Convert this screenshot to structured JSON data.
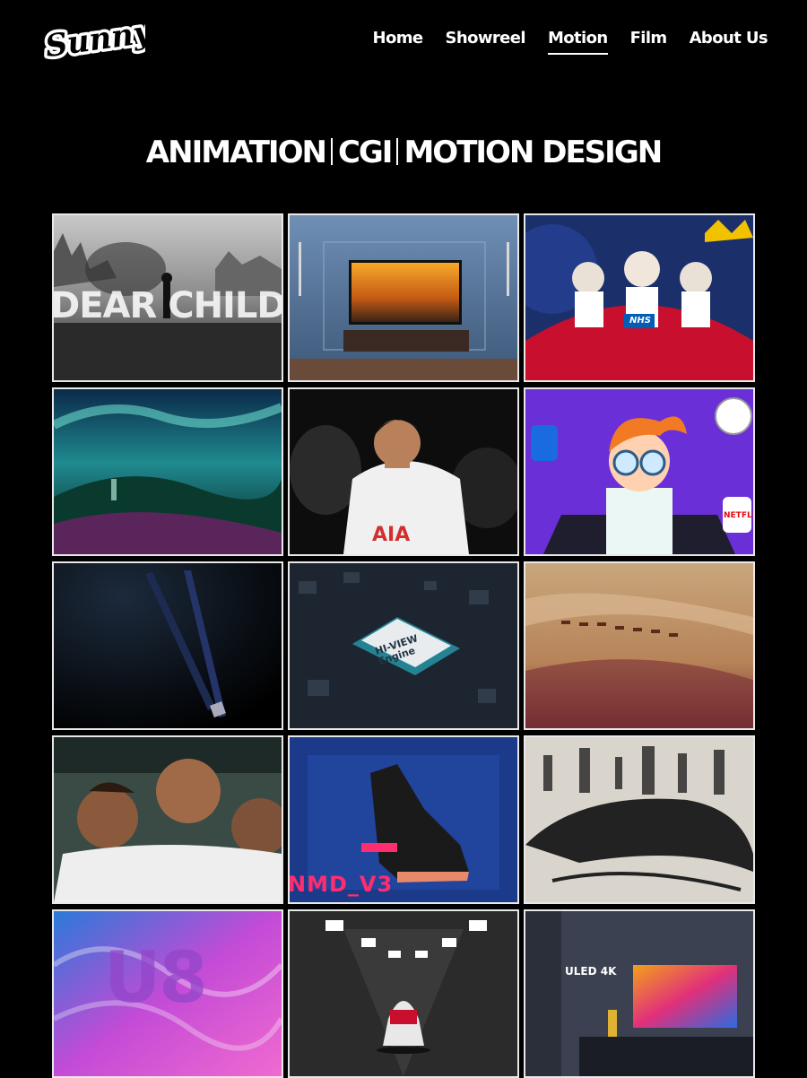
{
  "header": {
    "logo_text": "Sunny",
    "nav": [
      {
        "label": "Home",
        "active": false
      },
      {
        "label": "Showreel",
        "active": false
      },
      {
        "label": "Motion",
        "active": true
      },
      {
        "label": "Film",
        "active": false
      },
      {
        "label": "About Us",
        "active": false
      }
    ]
  },
  "page": {
    "title_parts": [
      "ANIMATION",
      "CGI",
      "MOTION DESIGN"
    ]
  },
  "tiles": [
    {
      "caption": "DEAR CHILD"
    },
    {
      "caption": ""
    },
    {
      "caption": "NHS"
    },
    {
      "caption": ""
    },
    {
      "caption": "AIA"
    },
    {
      "caption": "NETFLIX"
    },
    {
      "caption": ""
    },
    {
      "caption": "HI-VIEW Engine"
    },
    {
      "caption": ""
    },
    {
      "caption": ""
    },
    {
      "caption": "NMD_V3"
    },
    {
      "caption": ""
    },
    {
      "caption": "U8"
    },
    {
      "caption": ""
    },
    {
      "caption": "ULED 4K"
    }
  ],
  "colors": {
    "background": "#000000",
    "text": "#ffffff",
    "tile_border": "#e8e8e8",
    "accent_pink": "#ff2d6f"
  }
}
